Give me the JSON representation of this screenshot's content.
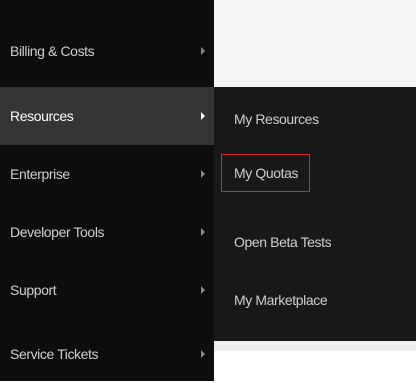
{
  "main_menu": {
    "items": [
      {
        "label": "Billing & Costs",
        "active": false
      },
      {
        "label": "Resources",
        "active": true
      },
      {
        "label": "Enterprise",
        "active": false
      },
      {
        "label": "Developer Tools",
        "active": false
      },
      {
        "label": "Support",
        "active": false
      },
      {
        "label": "Service Tickets",
        "active": false
      }
    ]
  },
  "sub_menu": {
    "items": [
      {
        "label": "My Resources"
      },
      {
        "label": "My Quotas",
        "highlighted": true
      },
      {
        "label": "Open Beta Tests"
      },
      {
        "label": "My Marketplace"
      }
    ]
  },
  "colors": {
    "main_bg": "#0d0d0d",
    "active_bg": "#353535",
    "sub_bg": "#181818",
    "highlight_border": "#d4262c"
  }
}
